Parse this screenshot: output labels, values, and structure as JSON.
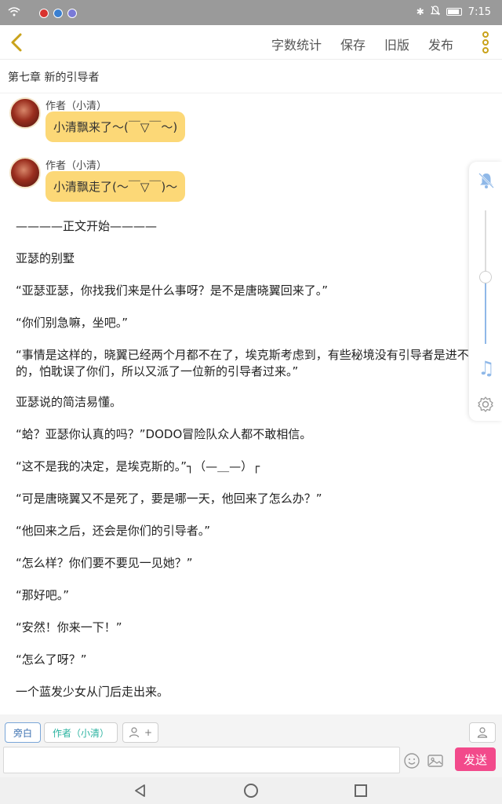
{
  "status_bar": {
    "time": "7:15"
  },
  "toolbar": {
    "buttons": [
      "字数统计",
      "保存",
      "旧版",
      "发布"
    ]
  },
  "chapter_title": "第七章 新的引导者",
  "messages": [
    {
      "author": "作者（小清）",
      "text": "小清飘来了～(￣▽￣～)"
    },
    {
      "author": "作者（小清）",
      "text": "小清飘走了(～￣▽￣)～"
    }
  ],
  "paragraphs": [
    "————正文开始————",
    "亚瑟的别墅",
    "“亚瑟亚瑟，你找我们来是什么事呀？是不是唐晓翼回来了。”",
    "“你们别急嘛，坐吧。”",
    "“事情是这样的，晓翼已经两个月都不在了，埃克斯考虑到，有些秘境没有引导者是进不去的，怕耽误了你们，所以又派了一位新的引导者过来。”",
    "亚瑟说的简洁易懂。",
    "“蛤？亚瑟你认真的吗？”DODO冒险队众人都不敢相信。",
    "“这不是我的决定，是埃克斯的。”┐（—＿—）┌",
    "“可是唐晓翼又不是死了，要是哪一天，他回来了怎么办？”",
    "“他回来之后，还会是你们的引导者。”",
    "“怎么样？你们要不要见一见她？”",
    "“那好吧。”",
    "“安然！你来一下！”",
    "“怎么了呀？”",
    "一个蓝发少女从门后走出来。"
  ],
  "side_panel": {
    "volume_level": 0.5,
    "music_icon": "♫"
  },
  "roles": {
    "aside": "旁白",
    "author": "作者（小清）",
    "add": "+"
  },
  "input": {
    "value": "",
    "placeholder": ""
  },
  "send_label": "发送",
  "colors": {
    "accent": "#c9a21a",
    "bubble": "#fcd877",
    "send": "#f24a8b",
    "status_bar": "#9a9a9a"
  }
}
